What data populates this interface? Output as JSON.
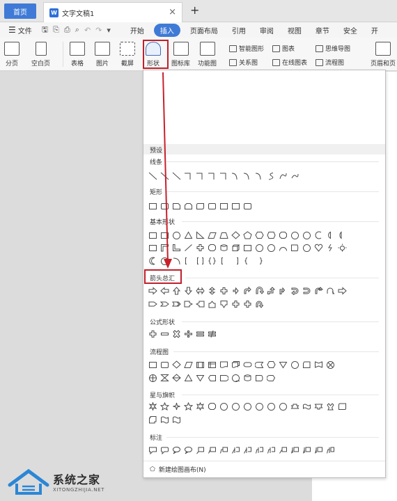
{
  "tabs": {
    "home": "首页",
    "document": "文字文稿1",
    "close": "×",
    "add": "+"
  },
  "menubar": {
    "file": "文件",
    "items": [
      "开始",
      "插入",
      "页面布局",
      "引用",
      "审阅",
      "视图",
      "章节",
      "安全",
      "开"
    ],
    "active_index": 1
  },
  "ribbon": {
    "page_break": "分页",
    "blank_page": "空白页",
    "table": "表格",
    "picture": "图片",
    "screenshot": "截屏",
    "shape": "形状",
    "icon_lib": "图标库",
    "function_chart": "功能图",
    "smart_art": "智能图形",
    "chart": "图表",
    "mind_map": "思维导图",
    "relation": "关系图",
    "online_chart": "在线图表",
    "flowchart": "流程图",
    "header_footer": "页眉和页"
  },
  "dropdown": {
    "header": "预设",
    "sections": [
      "线条",
      "矩形",
      "基本形状",
      "箭头总汇",
      "公式形状",
      "流程图",
      "星与旗帜",
      "标注"
    ],
    "footer": "新建绘图画布(N)"
  },
  "watermark": {
    "cn": "系统之家",
    "en": "XITONGZHIJIA.NET"
  },
  "colors": {
    "accent": "#3f7ad6",
    "highlight": "#c0202a"
  }
}
